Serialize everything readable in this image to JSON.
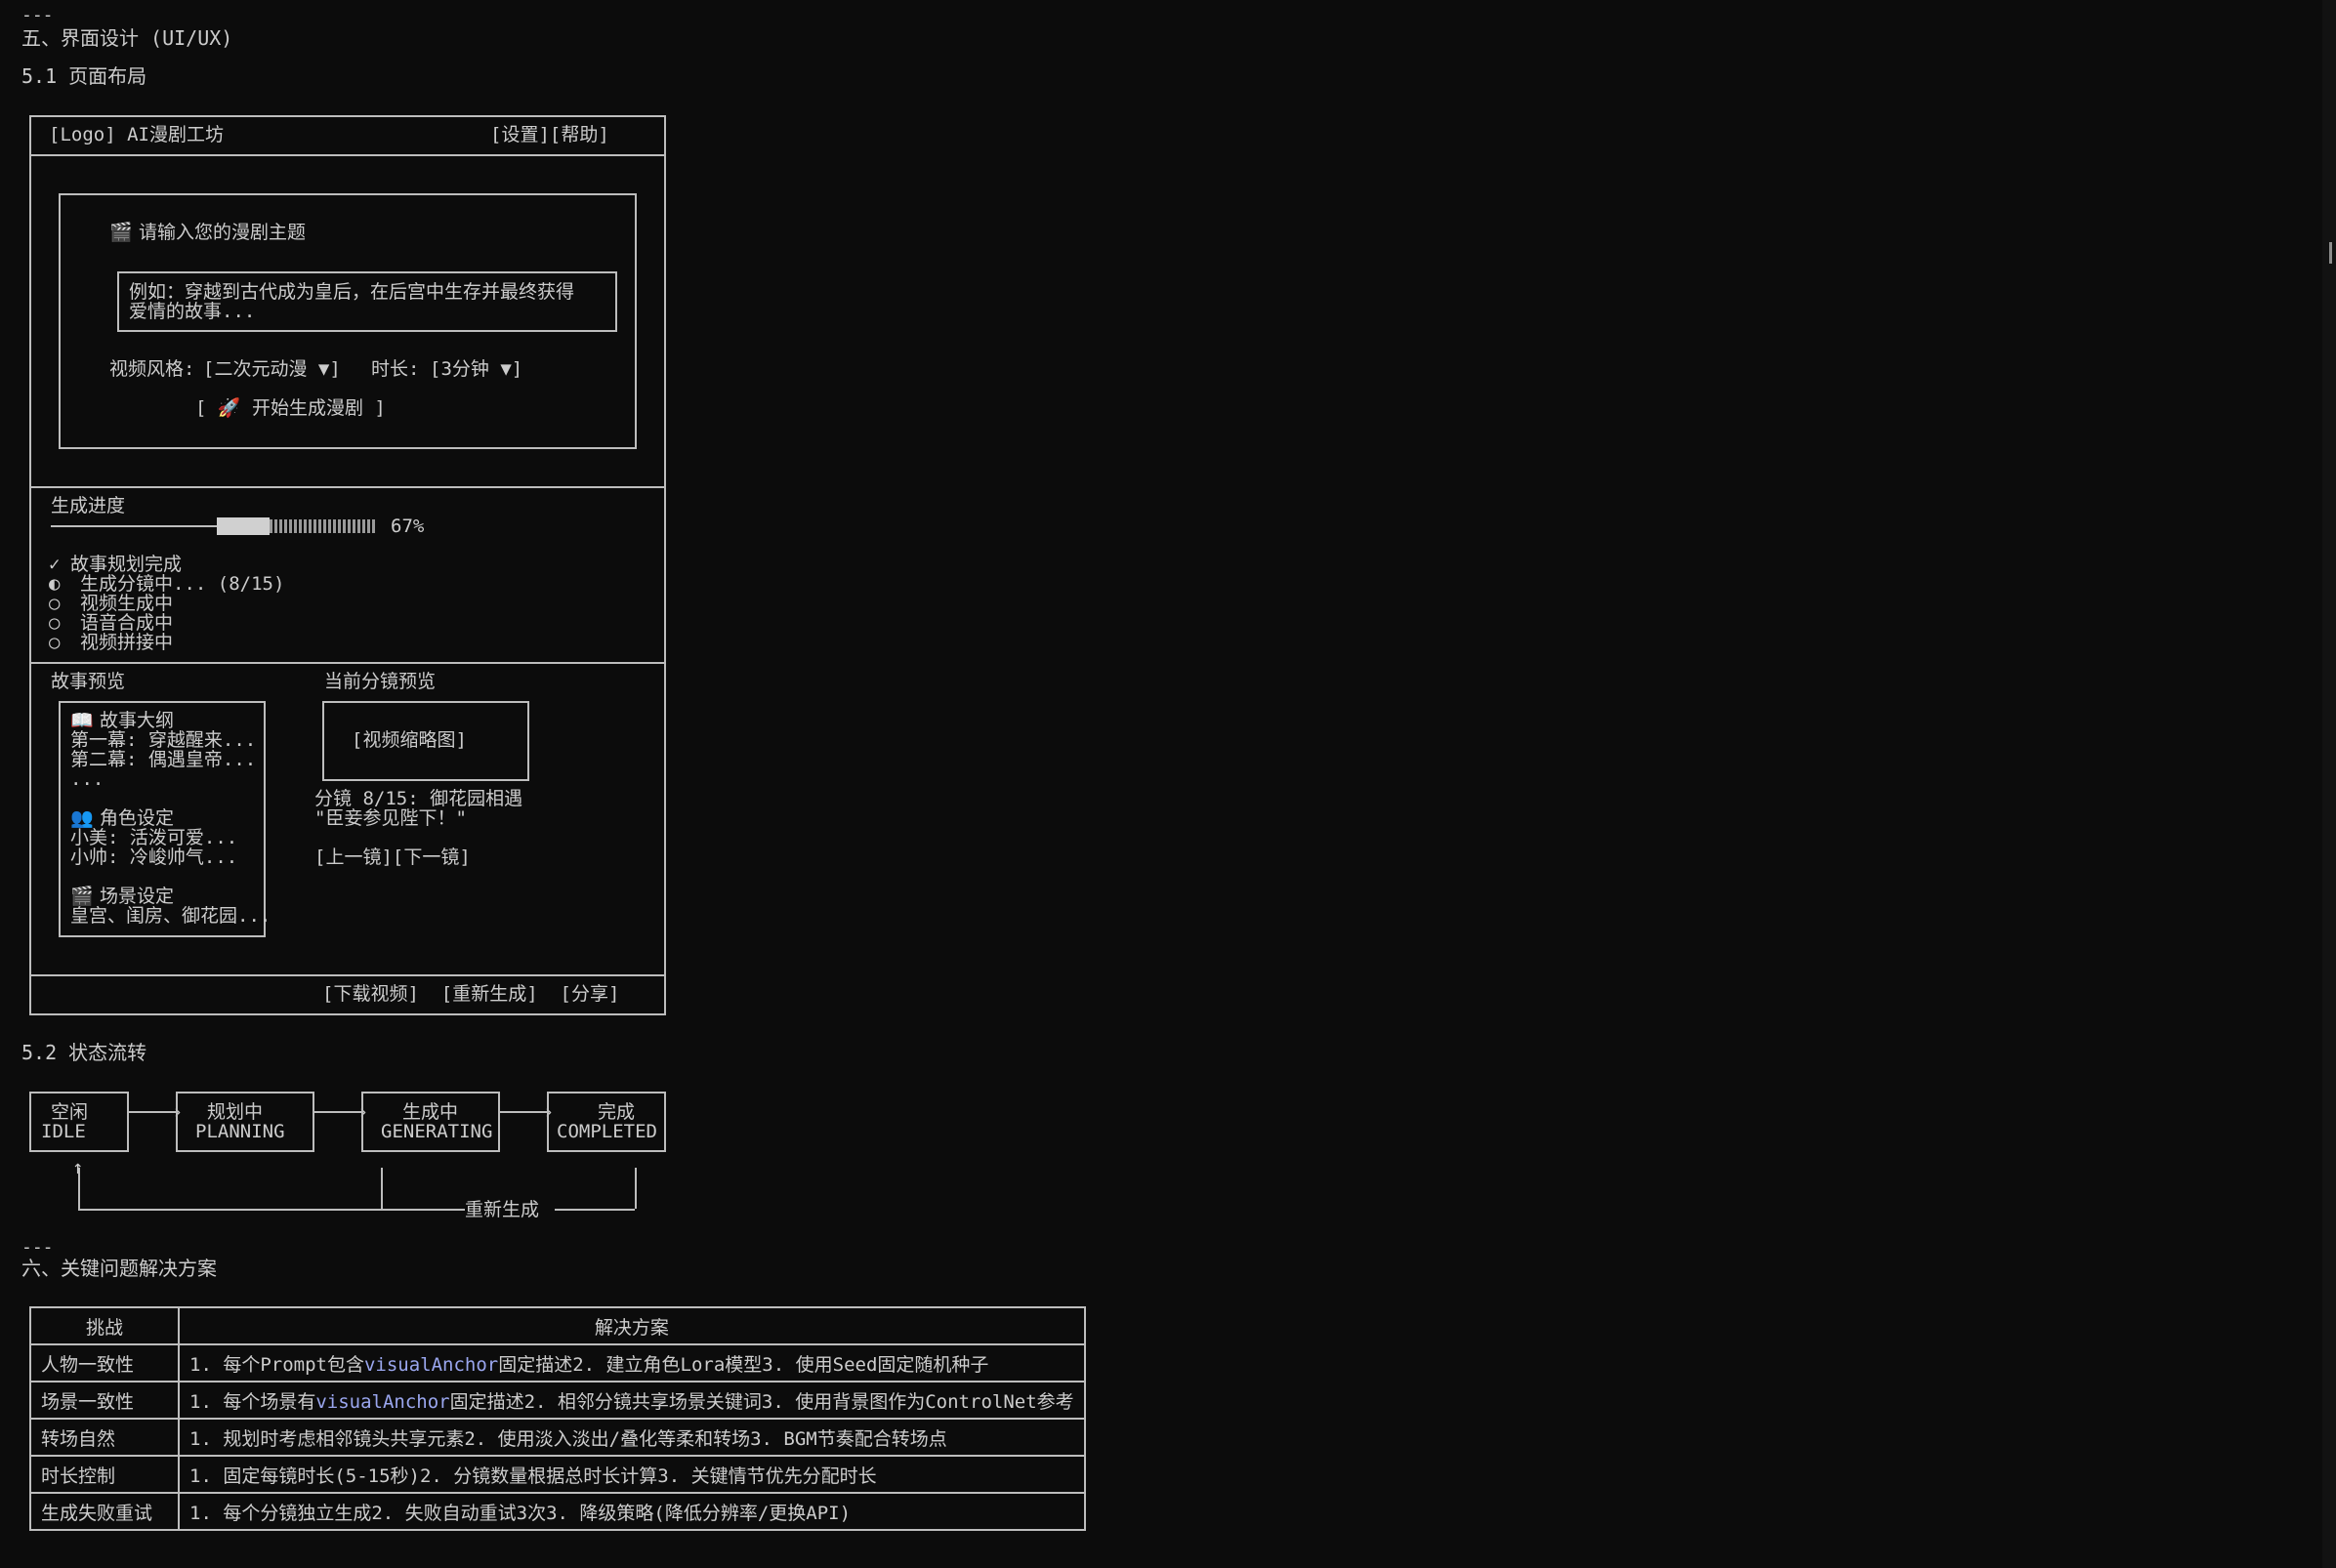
{
  "doc": {
    "separator": "---",
    "section5_title": "五、界面设计 (UI/UX)",
    "s51_title": "5.1 页面布局",
    "header_logo": "[Logo] AI漫剧工坊",
    "header_links": "[设置][帮助]",
    "input_prompt": "请输入您的漫剧主题",
    "input_placeholder_line1": "例如：穿越到古代成为皇后，在后宫中生存并最终获得",
    "input_placeholder_line2": "爱情的故事...",
    "style_label": "视频风格:",
    "style_value": "[二次元动漫 ▼]",
    "duration_label": "时长:",
    "duration_value": "[3分钟 ▼]",
    "start_button": "[ 🚀 开始生成漫剧 ]",
    "progress_title": "生成进度",
    "progress_percent": "67%",
    "progress_fraction": 0.67,
    "steps": [
      {
        "mark": "✓",
        "text": "故事规划完成"
      },
      {
        "mark": "◐",
        "text": "生成分镜中... (8/15)"
      },
      {
        "mark": "○",
        "text": "视频生成中"
      },
      {
        "mark": "○",
        "text": "语音合成中"
      },
      {
        "mark": "○",
        "text": "视频拼接中"
      }
    ],
    "story_preview_title": "故事预览",
    "outline_title": "故事大纲",
    "outline_line1": "第一幕: 穿越醒来...",
    "outline_line2": "第二幕: 偶遇皇帝...",
    "outline_line3": "...",
    "roles_title": "角色设定",
    "roles_line1": "小美: 活泼可爱...",
    "roles_line2": "小帅: 冷峻帅气...",
    "scenes_title": "场景设定",
    "scenes_line1": "皇宫、闺房、御花园...",
    "shot_preview_title": "当前分镜预览",
    "thumbnail_label": "[视频缩略图]",
    "shot_caption_line1": "分镜 8/15: 御花园相遇",
    "shot_caption_line2": "\"臣妾参见陛下！\"",
    "shot_nav": "[上一镜][下一镜]",
    "footer_actions": "[下载视频]  [重新生成]  [分享]",
    "s52_title": "5.2 状态流转",
    "states": [
      {
        "cn": "空闲",
        "en": "IDLE"
      },
      {
        "cn": "规划中",
        "en": "PLANNING"
      },
      {
        "cn": "生成中",
        "en": "GENERATING"
      },
      {
        "cn": "完成",
        "en": "COMPLETED"
      }
    ],
    "regenerate_label": "重新生成",
    "separator2": "---",
    "section6_title": "六、关键问题解决方案",
    "table_headers": [
      "挑战",
      "解决方案"
    ],
    "table_rows": [
      {
        "challenge": "人物一致性",
        "pre": "1. 每个Prompt包含",
        "code": "visualAnchor",
        "post": "固定描述2. 建立角色Lora模型3. 使用Seed固定随机种子"
      },
      {
        "challenge": "场景一致性",
        "pre": "1. 每个场景有",
        "code": "visualAnchor",
        "post": "固定描述2. 相邻分镜共享场景关键词3. 使用背景图作为ControlNet参考"
      },
      {
        "challenge": "转场自然",
        "pre": "1. 规划时考虑相邻镜头共享元素2. 使用淡入淡出/叠化等柔和转场3. BGM节奏配合转场点",
        "code": "",
        "post": ""
      },
      {
        "challenge": "时长控制",
        "pre": "1. 固定每镜时长(5-15秒)2. 分镜数量根据总时长计算3. 关键情节优先分配时长",
        "code": "",
        "post": ""
      },
      {
        "challenge": "生成失败重试",
        "pre": "1. 每个分镜独立生成2. 失败自动重试3次3. 降级策略(降低分辨率/更换API)",
        "code": "",
        "post": ""
      }
    ]
  }
}
